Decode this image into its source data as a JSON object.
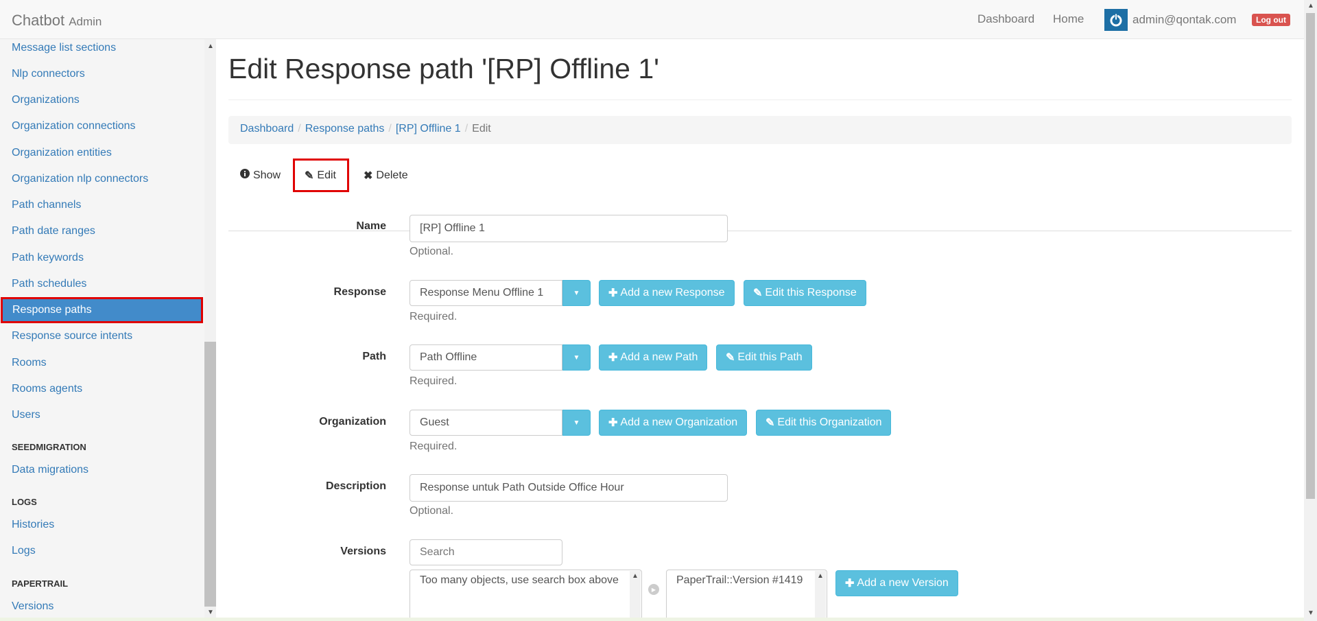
{
  "app": {
    "brand": "Chatbot",
    "brand_sub": "Admin"
  },
  "topnav": {
    "dashboard": "Dashboard",
    "home": "Home",
    "user_email": "admin@qontak.com",
    "logout": "Log out"
  },
  "sidebar": {
    "items": [
      "Message list sections",
      "Nlp connectors",
      "Organizations",
      "Organization connections",
      "Organization entities",
      "Organization nlp connectors",
      "Path channels",
      "Path date ranges",
      "Path keywords",
      "Path schedules",
      "Response paths",
      "Response source intents",
      "Rooms",
      "Rooms agents",
      "Users"
    ],
    "active_item": "Response paths",
    "sections": [
      {
        "heading": "SEEDMIGRATION",
        "items": [
          "Data migrations"
        ]
      },
      {
        "heading": "LOGS",
        "items": [
          "Histories",
          "Logs"
        ]
      },
      {
        "heading": "PAPERTRAIL",
        "items": [
          "Versions"
        ]
      }
    ]
  },
  "page": {
    "title": "Edit Response path '[RP] Offline 1'"
  },
  "breadcrumb": {
    "items": [
      "Dashboard",
      "Response paths",
      "[RP] Offline 1"
    ],
    "current": "Edit"
  },
  "actions": {
    "show": "Show",
    "edit": "Edit",
    "delete": "Delete"
  },
  "form": {
    "name": {
      "label": "Name",
      "value": "[RP] Offline 1",
      "help": "Optional."
    },
    "response": {
      "label": "Response",
      "value": "Response Menu Offline 1",
      "help": "Required.",
      "add_label": "Add a new Response",
      "edit_label": "Edit this Response"
    },
    "path": {
      "label": "Path",
      "value": "Path Offline",
      "help": "Required.",
      "add_label": "Add a new Path",
      "edit_label": "Edit this Path"
    },
    "organization": {
      "label": "Organization",
      "value": "Guest",
      "help": "Required.",
      "add_label": "Add a new Organization",
      "edit_label": "Edit this Organization"
    },
    "description": {
      "label": "Description",
      "value": "Response untuk Path Outside Office Hour",
      "help": "Optional."
    },
    "versions": {
      "label": "Versions",
      "search_placeholder": "Search",
      "available_note": "Too many objects, use search box above",
      "selected": [
        "PaperTrail::Version #1419"
      ],
      "add_label": "Add a new Version"
    }
  },
  "icons": {
    "show": "info-circle-icon",
    "edit": "pencil-icon",
    "delete": "close-icon",
    "add": "plus-icon",
    "user": "power-icon"
  },
  "colors": {
    "link": "#337ab7",
    "info_button": "#5bc0de",
    "active_sidebar": "#428bca",
    "logout": "#d9534f",
    "highlight_box": "#e00000"
  }
}
